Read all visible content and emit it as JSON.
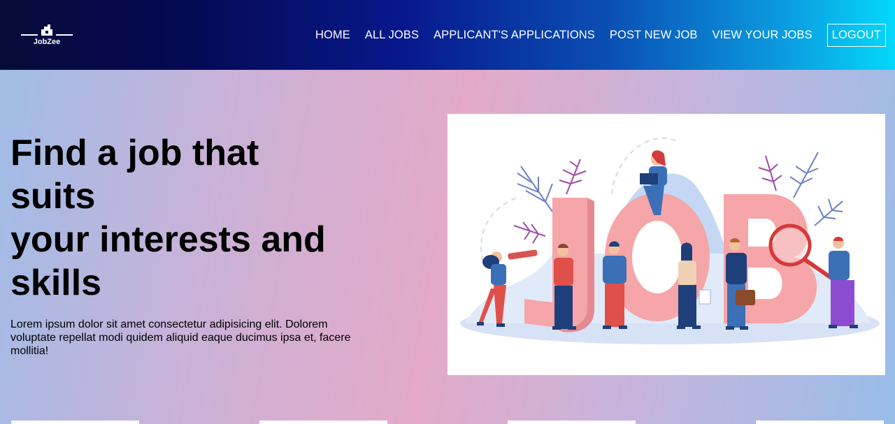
{
  "brand": {
    "name": "JobZee"
  },
  "nav": {
    "items": [
      {
        "label": "HOME"
      },
      {
        "label": "ALL JOBS"
      },
      {
        "label": "APPLICANT'S APPLICATIONS"
      },
      {
        "label": "POST NEW JOB"
      },
      {
        "label": "VIEW YOUR JOBS"
      }
    ],
    "logout_label": "LOGOUT"
  },
  "hero": {
    "title_lines": [
      "Find a job that",
      "suits",
      "your interests and",
      "skills"
    ],
    "description": "Lorem ipsum dolor sit amet consectetur adipisicing elit. Dolorem voluptate repellat modi quidem aliquid eaque ducimus ipsa et, facere mollitia!",
    "illustration": {
      "icon": "job-search-illustration",
      "letters": "JOB"
    }
  },
  "colors": {
    "nav_start": "#050a3a",
    "nav_end": "#04d8fb",
    "letter_pink": "#f6a5a8",
    "figure_blue": "#1f3f7a"
  }
}
